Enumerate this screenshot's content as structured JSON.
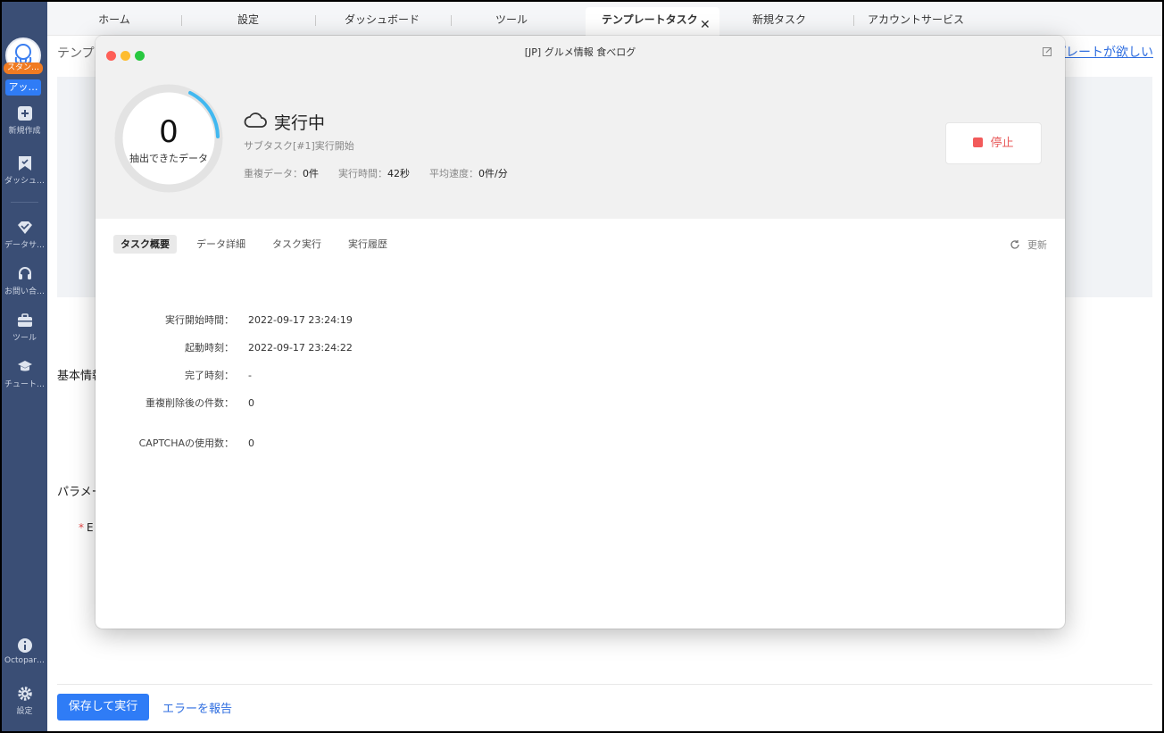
{
  "sidebar": {
    "avatar_badge": "スタン…",
    "upgrade_badge": "アッ…",
    "items": [
      {
        "label": "新規作成",
        "icon": "plus-square-icon"
      },
      {
        "label": "ダッシュ…",
        "icon": "bookmark-icon"
      },
      {
        "label": "データサ…",
        "icon": "diamond-icon"
      },
      {
        "label": "お問い合…",
        "icon": "headset-icon"
      },
      {
        "label": "ツール",
        "icon": "toolbox-icon"
      },
      {
        "label": "チュート…",
        "icon": "graduation-cap-icon"
      },
      {
        "label": "Octopar…",
        "icon": "info-icon"
      },
      {
        "label": "設定",
        "icon": "gear-icon"
      }
    ]
  },
  "tabs": [
    {
      "label": "ホーム"
    },
    {
      "label": "設定"
    },
    {
      "label": "ダッシュボード"
    },
    {
      "label": "ツール"
    },
    {
      "label": "テンプレートタスク",
      "active": true
    },
    {
      "label": "新規タスク"
    },
    {
      "label": "アカウントサービス"
    }
  ],
  "page": {
    "title": "テンプレ",
    "right_link": "プレートが欲しい",
    "basic_section": "基本情報",
    "param_section": "パラメー",
    "field_label": "E",
    "save_run": "保存して実行",
    "report_error": "エラーを報告"
  },
  "modal": {
    "title": "[JP] グルメ情報 食べログ",
    "extracted_count": "0",
    "extracted_label": "抽出できたデータ",
    "status": "実行中",
    "status_sub": "サブタスク[#1]実行開始",
    "stats": {
      "dup_label": "重複データ：",
      "dup_value": "0件",
      "time_label": "実行時間：",
      "time_value": "42秒",
      "speed_label": "平均速度：",
      "speed_value": "0件/分"
    },
    "stop_label": "停止",
    "subtabs": [
      "タスク概要",
      "データ詳細",
      "タスク実行",
      "実行履歴"
    ],
    "refresh_label": "更新",
    "details": [
      {
        "key": "実行開始時間：",
        "value": "2022-09-17 23:24:19"
      },
      {
        "key": "起動時刻：",
        "value": "2022-09-17 23:24:22"
      },
      {
        "key": "完了時刻：",
        "value": "-"
      },
      {
        "key": "重複削除後の件数：",
        "value": "0"
      },
      {
        "key": "CAPTCHAの使用数：",
        "value": "0"
      }
    ]
  },
  "colors": {
    "sidebar": "#3a4e75",
    "accent": "#2f7cf6",
    "stop": "#f25a5a",
    "ring": "#41b8f0"
  }
}
